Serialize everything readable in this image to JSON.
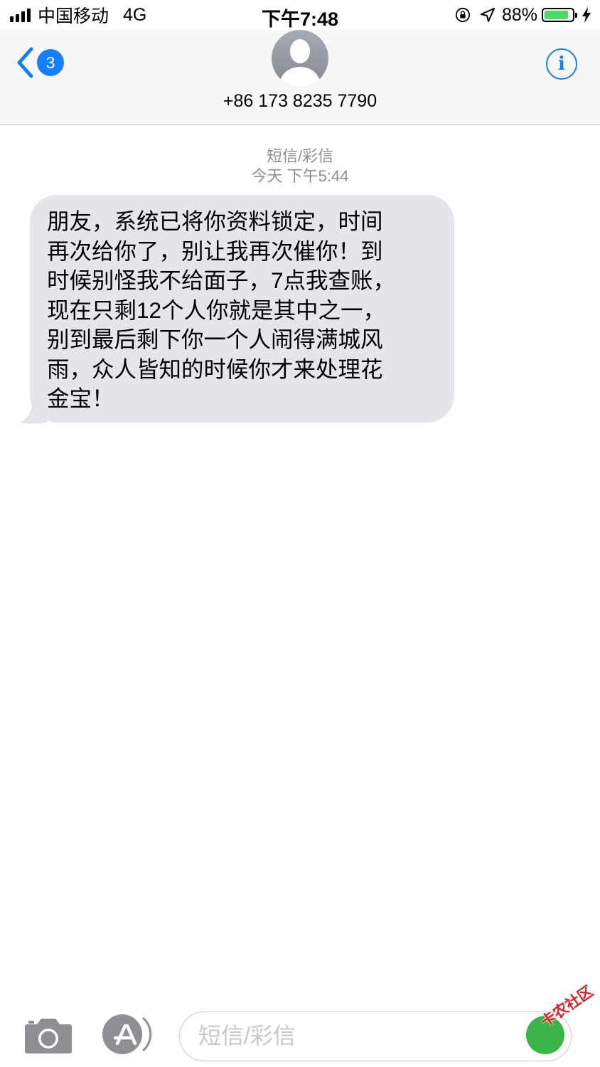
{
  "status_bar": {
    "carrier": "中国移动",
    "network": "4G",
    "time": "下午7:48",
    "battery_percent": "88%",
    "battery_level": 0.88,
    "battery_color": "#4cd964"
  },
  "header": {
    "back_badge_count": "3",
    "contact_number": "+86 173 8235 7790",
    "info_label": "i",
    "accent_color": "#147efb"
  },
  "conversation": {
    "message_type_label": "短信/彩信",
    "timestamp": "今天 下午5:44",
    "messages": [
      {
        "direction": "incoming",
        "text": "朋友，系统已将你资料锁定，时间\n再次给你了，别让我再次催你！到\n时候别怪我不给面子，7点我查账，\n现在只剩12个人你就是其中之一，\n别到最后剩下你一个人闹得满城风\n雨，众人皆知的时候你才来处理花\n金宝！"
      }
    ]
  },
  "composer": {
    "placeholder": "短信/彩信",
    "icons": [
      "camera-icon",
      "app-store-icon"
    ]
  },
  "watermark": {
    "text": "卡农社区"
  }
}
